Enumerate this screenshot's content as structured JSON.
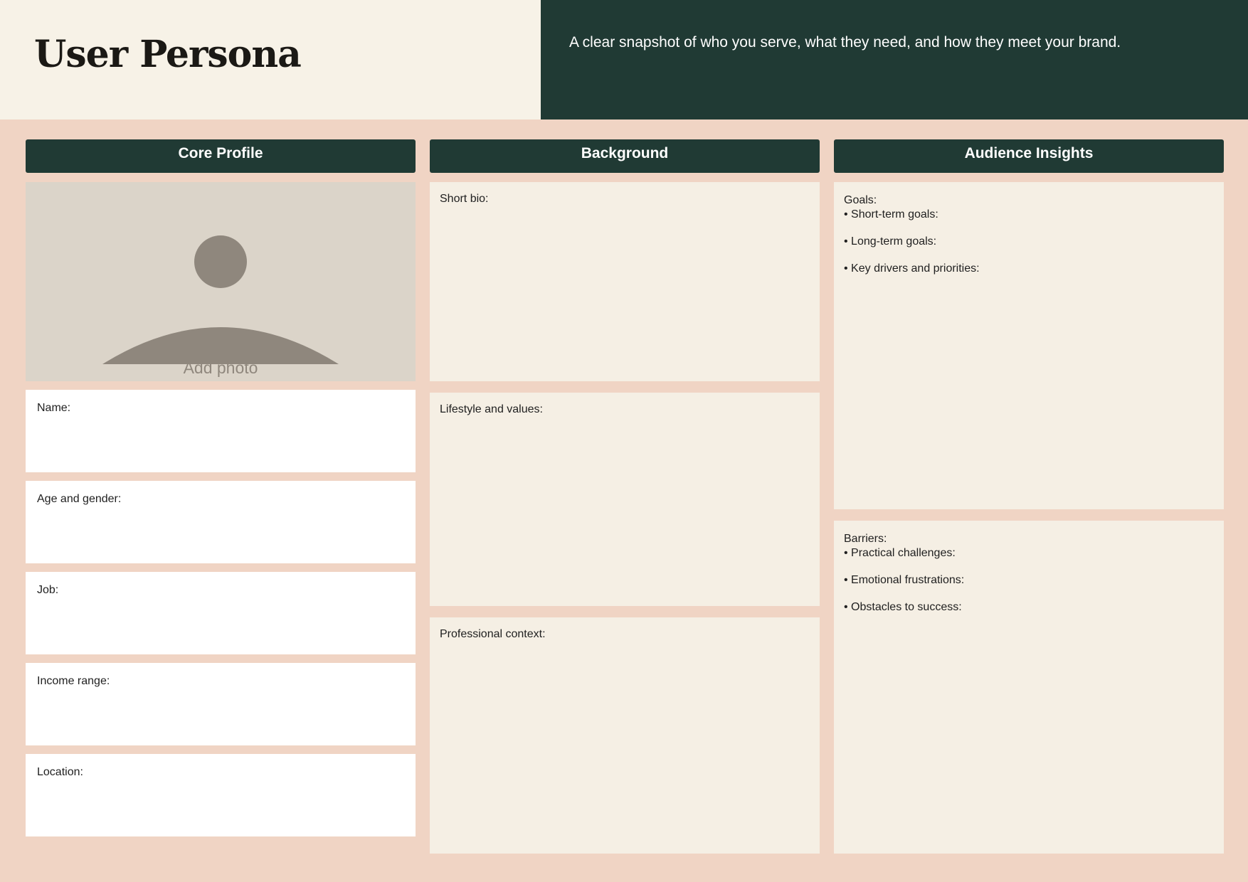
{
  "header": {
    "title": "User Persona",
    "tagline": "A clear snapshot of who you serve, what they need, and how they meet your brand."
  },
  "columns": {
    "core_profile": {
      "title": "Core Profile",
      "photo_label": "Add photo",
      "fields": [
        "Name:",
        "Age and gender:",
        "Job:",
        "Income range:",
        "Location:"
      ]
    },
    "background": {
      "title": "Background",
      "sections": [
        "Short bio:",
        "Lifestyle and values:",
        "Professional context:"
      ]
    },
    "audience_insights": {
      "title": "Audience Insights",
      "goals": {
        "label": "Goals:",
        "bullets": [
          "• Short-term goals:",
          "• Long-term goals:",
          "• Key drivers and priorities:"
        ]
      },
      "barriers": {
        "label": "Barriers:",
        "bullets": [
          "• Practical challenges:",
          "• Emotional frustrations:",
          "• Obstacles to success:"
        ]
      }
    }
  },
  "colors": {
    "page_bg": "#f0d4c4",
    "header_left_bg": "#f7f2e7",
    "dark_green": "#203a34",
    "card_white": "#ffffff",
    "card_cream": "#f5efe4",
    "photo_bg": "#dbd4c9",
    "photo_icon": "#8f877d"
  },
  "icons": {
    "photo_placeholder": "person-silhouette-icon"
  }
}
